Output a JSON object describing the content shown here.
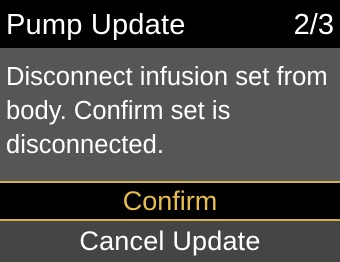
{
  "header": {
    "title": "Pump Update",
    "step": "2/3"
  },
  "message": {
    "text": "Disconnect infusion set from body. Confirm set is disconnected."
  },
  "actions": {
    "confirm_label": "Confirm",
    "cancel_label": "Cancel Update"
  },
  "colors": {
    "selected_text": "#e6bd4c",
    "selection_border": "#d4b04a",
    "message_background": "#565656",
    "unselected_background": "#454545"
  }
}
